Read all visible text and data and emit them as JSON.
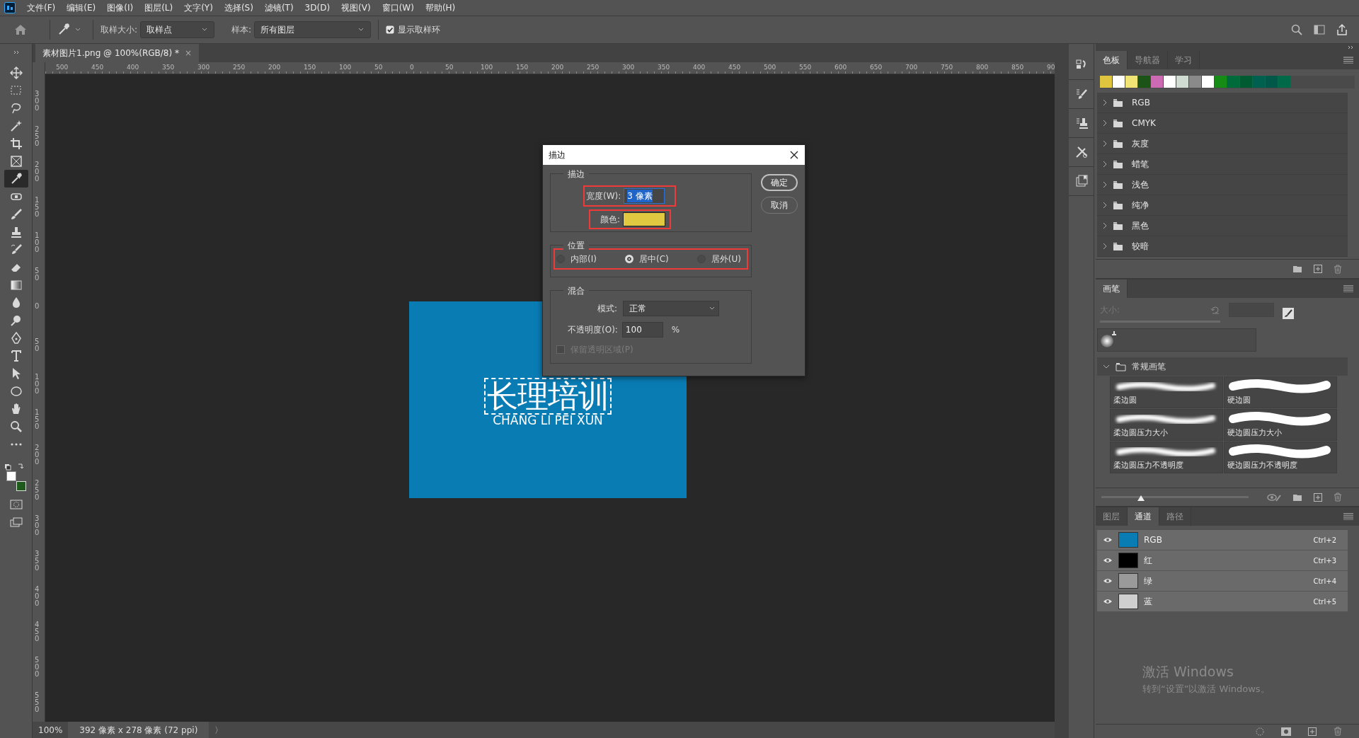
{
  "menu_bar": {
    "items": [
      "文件(F)",
      "编辑(E)",
      "图像(I)",
      "图层(L)",
      "文字(Y)",
      "选择(S)",
      "滤镜(T)",
      "3D(D)",
      "视图(V)",
      "窗口(W)",
      "帮助(H)"
    ]
  },
  "options_bar": {
    "sample_size_label": "取样大小:",
    "sample_size": "取样点",
    "sample_label": "样本:",
    "sample": "所有图层",
    "show_ring": {
      "label": "显示取样环",
      "checked": true
    }
  },
  "document_tab": {
    "title": "素材图片1.png @ 100%(RGB/8) *",
    "close": "×"
  },
  "rulers": {
    "horizontal": [
      "500",
      "450",
      "400",
      "350",
      "300",
      "250",
      "200",
      "150",
      "100",
      "50",
      "0",
      "50",
      "100",
      "150",
      "200",
      "250",
      "300",
      "350",
      "400",
      "450",
      "500",
      "550",
      "600",
      "650",
      "700",
      "750",
      "800",
      "850",
      "90"
    ],
    "vertical": [
      "300",
      "250",
      "200",
      "150",
      "100",
      "50",
      "0",
      "50",
      "100",
      "150",
      "200",
      "250",
      "300",
      "350",
      "400",
      "450",
      "500",
      "550"
    ]
  },
  "tools": [
    {
      "kind": "move",
      "selected": false
    },
    {
      "kind": "marquee",
      "selected": false
    },
    {
      "kind": "lasso",
      "selected": false
    },
    {
      "kind": "wand",
      "selected": false
    },
    {
      "kind": "crop",
      "selected": false
    },
    {
      "kind": "frame",
      "selected": false
    },
    {
      "kind": "eyedropper",
      "selected": true
    },
    {
      "kind": "patch",
      "selected": false
    },
    {
      "kind": "brush",
      "selected": false
    },
    {
      "kind": "stamp",
      "selected": false
    },
    {
      "kind": "history",
      "selected": false
    },
    {
      "kind": "eraser",
      "selected": false
    },
    {
      "kind": "gradient",
      "selected": false
    },
    {
      "kind": "drop",
      "selected": false
    },
    {
      "kind": "dodge",
      "selected": false
    },
    {
      "kind": "pen",
      "selected": false
    },
    {
      "kind": "type",
      "selected": false
    },
    {
      "kind": "select",
      "selected": false
    },
    {
      "kind": "ellipse",
      "selected": false
    },
    {
      "kind": "hand",
      "selected": false
    },
    {
      "kind": "zoom",
      "selected": false
    },
    {
      "kind": "more",
      "selected": false
    }
  ],
  "color_swatches": [
    {
      "kind": "foreground",
      "color": "#ffffff"
    },
    {
      "kind": "background",
      "color": "#1d5a1b"
    }
  ],
  "canvas": {
    "color": "#0a7cb4",
    "title": "长理培训",
    "subtitle": "CHANG LI PEI XUN"
  },
  "dialog": {
    "title": "描边",
    "stroke": {
      "legend": "描边",
      "width": {
        "label": "宽度(W):",
        "value": "3 像素",
        "highlighted": true
      },
      "color": {
        "label": "颜色:",
        "color": "#e0c840",
        "highlighted": true
      }
    },
    "location": {
      "legend": "位置",
      "highlighted": true,
      "options": [
        {
          "label": "内部(I)",
          "selected": false
        },
        {
          "label": "居中(C)",
          "selected": true
        },
        {
          "label": "居外(U)",
          "selected": false
        }
      ]
    },
    "blending": {
      "legend": "混合",
      "mode_label": "模式:",
      "mode": "正常",
      "opacity_label": "不透明度(O):",
      "opacity": "100",
      "unit": "%",
      "preserve": {
        "label": "保留透明区域(P)",
        "checked": false,
        "disabled": true
      }
    },
    "buttons": [
      "确定",
      "取消"
    ]
  },
  "swatches_panel": {
    "tabs": [
      {
        "label": "色板",
        "selected": true
      },
      {
        "label": "导航器",
        "selected": false
      },
      {
        "label": "学习",
        "selected": false
      }
    ],
    "swatches": [
      {
        "color": "#e0c63f"
      },
      {
        "color": "#ffffff"
      },
      {
        "color": "#f0e474"
      },
      {
        "color": "#1c5418"
      },
      {
        "color": "#cc6ab4"
      },
      {
        "color": "#ffffff"
      },
      {
        "color": "#d0dcd2"
      },
      {
        "color": "#8a8a8a"
      },
      {
        "color": "#ffffff"
      },
      {
        "color": "#168c16"
      },
      {
        "color": "#006b3a"
      },
      {
        "color": "#005a32"
      },
      {
        "color": "#006050"
      },
      {
        "color": "#005848"
      },
      {
        "color": "#006a48"
      }
    ],
    "folders": [
      "RGB",
      "CMYK",
      "灰度",
      "蜡笔",
      "浅色",
      "纯净",
      "黑色",
      "较暗"
    ]
  },
  "brush_panel": {
    "tab": "画笔",
    "size_label": "大小:",
    "group": {
      "name": "常规画笔",
      "expanded": true
    },
    "brushes": [
      {
        "name": "柔边圆",
        "kind": "soft"
      },
      {
        "name": "硬边圆",
        "kind": "hard"
      },
      {
        "name": "柔边圆压力大小",
        "kind": "soft"
      },
      {
        "name": "硬边圆压力大小",
        "kind": "hard"
      },
      {
        "name": "柔边圆压力不透明度",
        "kind": "soft"
      },
      {
        "name": "硬边圆压力不透明度",
        "kind": "hard"
      }
    ],
    "slider": {
      "level": 0.27
    }
  },
  "channels_panel": {
    "tabs": [
      {
        "label": "图层",
        "selected": false
      },
      {
        "label": "通道",
        "selected": true
      },
      {
        "label": "路径",
        "selected": false
      }
    ],
    "channels": [
      {
        "name": "RGB",
        "shortcut": "Ctrl+2",
        "color": "#0a7cb4"
      },
      {
        "name": "红",
        "shortcut": "Ctrl+3",
        "color": "#000000"
      },
      {
        "name": "绿",
        "shortcut": "Ctrl+4",
        "color": "#9a9a9a"
      },
      {
        "name": "蓝",
        "shortcut": "Ctrl+5",
        "color": "#cfcfcf"
      }
    ]
  },
  "status_bar": {
    "zoom": "100%",
    "info": "392 像素 x 278 像素 (72 ppi)",
    "arrow": "〉"
  },
  "windows_notice": {
    "title": "激活 Windows",
    "text": "转到“设置”以激活 Windows。"
  }
}
